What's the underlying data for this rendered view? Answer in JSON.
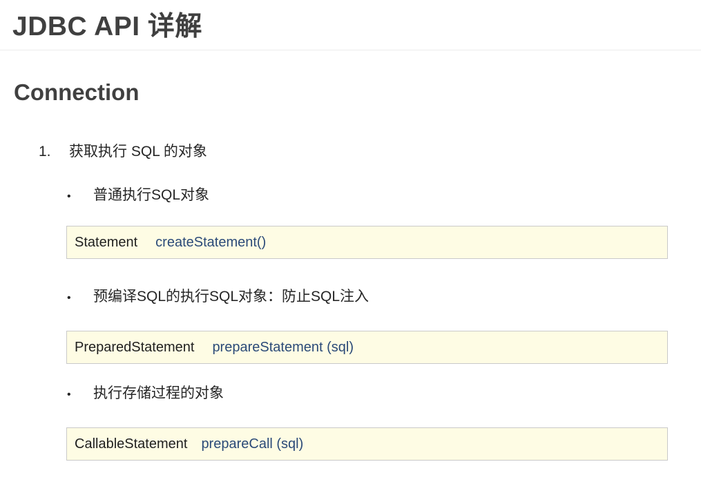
{
  "header": {
    "title": "JDBC API 详解"
  },
  "section": {
    "heading": "Connection"
  },
  "list": {
    "item1_number": "1.",
    "item1_text": "获取执行 SQL 的对象"
  },
  "bullets": [
    {
      "symbol": "•",
      "text": "普通执行SQL对象",
      "code_type": "Statement",
      "code_method": "createStatement()"
    },
    {
      "symbol": "•",
      "text": "预编译SQL的执行SQL对象：防止SQL注入",
      "code_type": "PreparedStatement",
      "code_method": "prepareStatement (sql)"
    },
    {
      "symbol": "•",
      "text": "执行存储过程的对象",
      "code_type": "CallableStatement",
      "code_method": "prepareCall (sql)"
    }
  ],
  "colors": {
    "code_background": "#fefce4",
    "code_border": "#c9c9c9",
    "method_text": "#2b4a78",
    "heading_text": "#404040"
  }
}
